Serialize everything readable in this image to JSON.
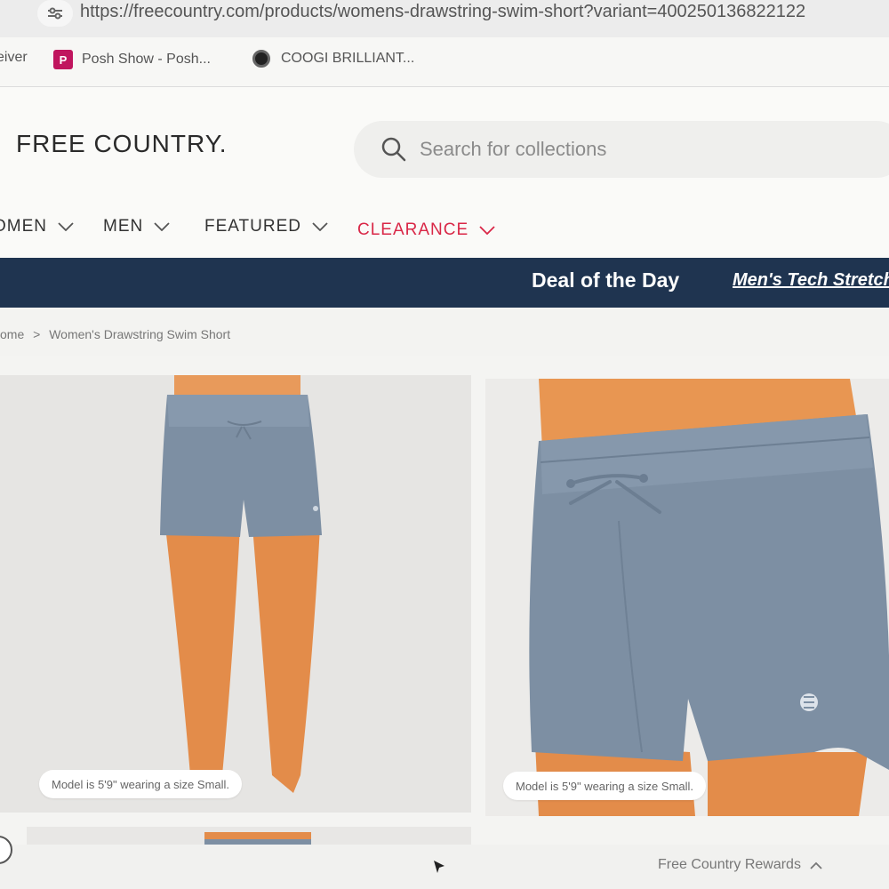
{
  "browser": {
    "url": "https://freecountry.com/products/womens-drawstring-swim-short?variant=400250136822122",
    "bookmarks": [
      {
        "label": "eiver",
        "icon": "none"
      },
      {
        "label": "Posh Show - Posh...",
        "icon": "poshmark-icon"
      },
      {
        "label": "COOGI BRILLIANT...",
        "icon": "coogi-icon"
      }
    ]
  },
  "header": {
    "logo": "FREE COUNTRY.",
    "search_placeholder": "Search for collections",
    "nav": [
      {
        "label": "OMEN"
      },
      {
        "label": "MEN"
      },
      {
        "label": "FEATURED"
      },
      {
        "label": "CLEARANCE"
      }
    ],
    "clearance_color": "#d92747"
  },
  "promo": {
    "title": "Deal of the Day",
    "link": "Men's Tech Stretch",
    "background": "#1f3450"
  },
  "breadcrumb": {
    "home": "ome",
    "separator": ">",
    "current": "Women's Drawstring Swim Short"
  },
  "gallery": {
    "captions": [
      "Model is 5'9\" wearing a size Small.",
      "Model is 5'9\" wearing a size Small."
    ],
    "product_color": "#7d8fa3"
  },
  "footer": {
    "rewards": "Free Country Rewards"
  }
}
